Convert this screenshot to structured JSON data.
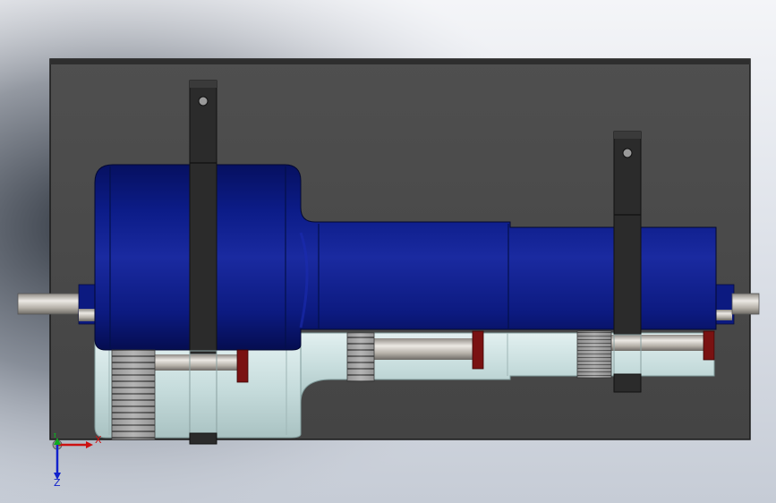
{
  "axes": {
    "x_label": "X",
    "y_label": "Y",
    "z_label": "Z"
  },
  "colors": {
    "background_top": "#f4f5f8",
    "base_plate": "#4a4a4a",
    "housing_upper": "#0a1a7a",
    "housing_lower": "#c9dede",
    "shaft": "#b9b5ae",
    "bracket": "#2b2b2b",
    "gear": "#9a9a9a",
    "red_part": "#7a1212",
    "axis_x": "#cc1111",
    "axis_y": "#11aa22",
    "axis_z": "#1122cc"
  }
}
